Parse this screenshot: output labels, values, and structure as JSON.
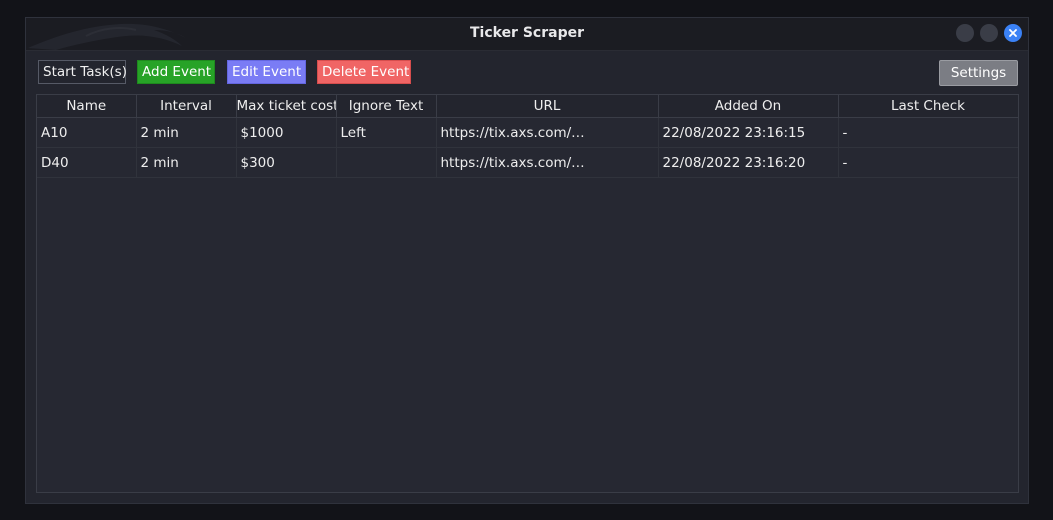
{
  "window": {
    "title": "Ticker Scraper"
  },
  "toolbar": {
    "start_label": "Start Task(s)",
    "add_label": "Add Event",
    "edit_label": "Edit Event",
    "delete_label": "Delete Event",
    "settings_label": "Settings"
  },
  "table": {
    "headers": [
      "Name",
      "Interval",
      "Max ticket cost",
      "Ignore Text",
      "URL",
      "Added On",
      "Last Check"
    ],
    "rows": [
      [
        "A10",
        "2 min",
        "$1000",
        "Left",
        "https://tix.axs.com/…",
        "22/08/2022 23:16:15",
        "-"
      ],
      [
        "D40",
        "2 min",
        "$300",
        "",
        "https://tix.axs.com/…",
        "22/08/2022 23:16:20",
        "-"
      ]
    ]
  },
  "colors": {
    "add": "#27a327",
    "edit": "#7a7cf5",
    "delete": "#f06565",
    "close": "#3b82f6"
  }
}
